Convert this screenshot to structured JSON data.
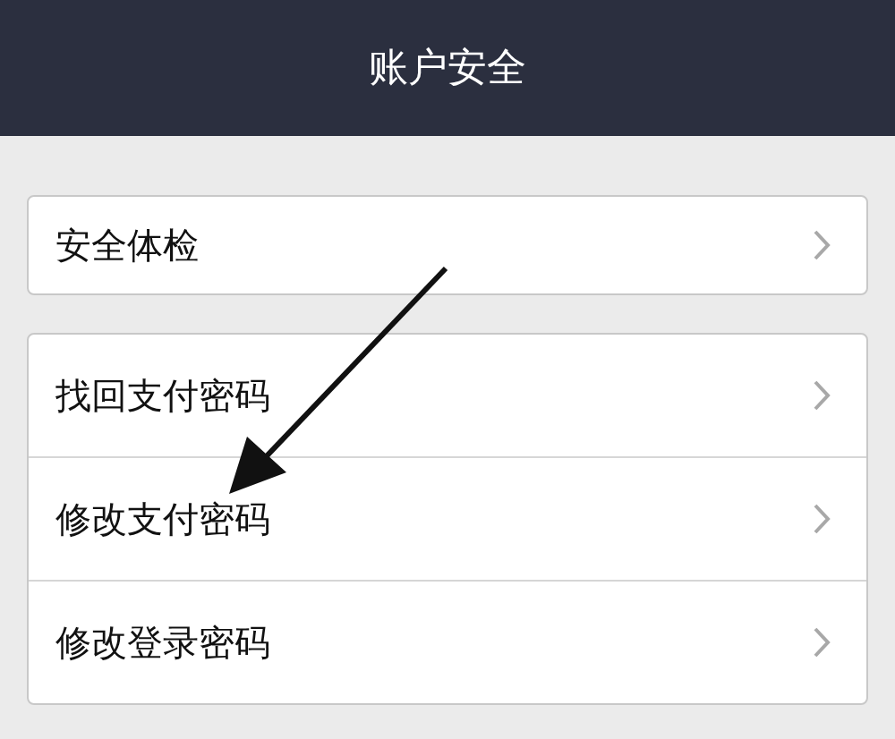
{
  "header": {
    "title": "账户安全"
  },
  "groups": [
    {
      "items": [
        {
          "label": "安全体检"
        }
      ]
    },
    {
      "items": [
        {
          "label": "找回支付密码"
        },
        {
          "label": "修改支付密码"
        },
        {
          "label": "修改登录密码"
        }
      ]
    }
  ]
}
